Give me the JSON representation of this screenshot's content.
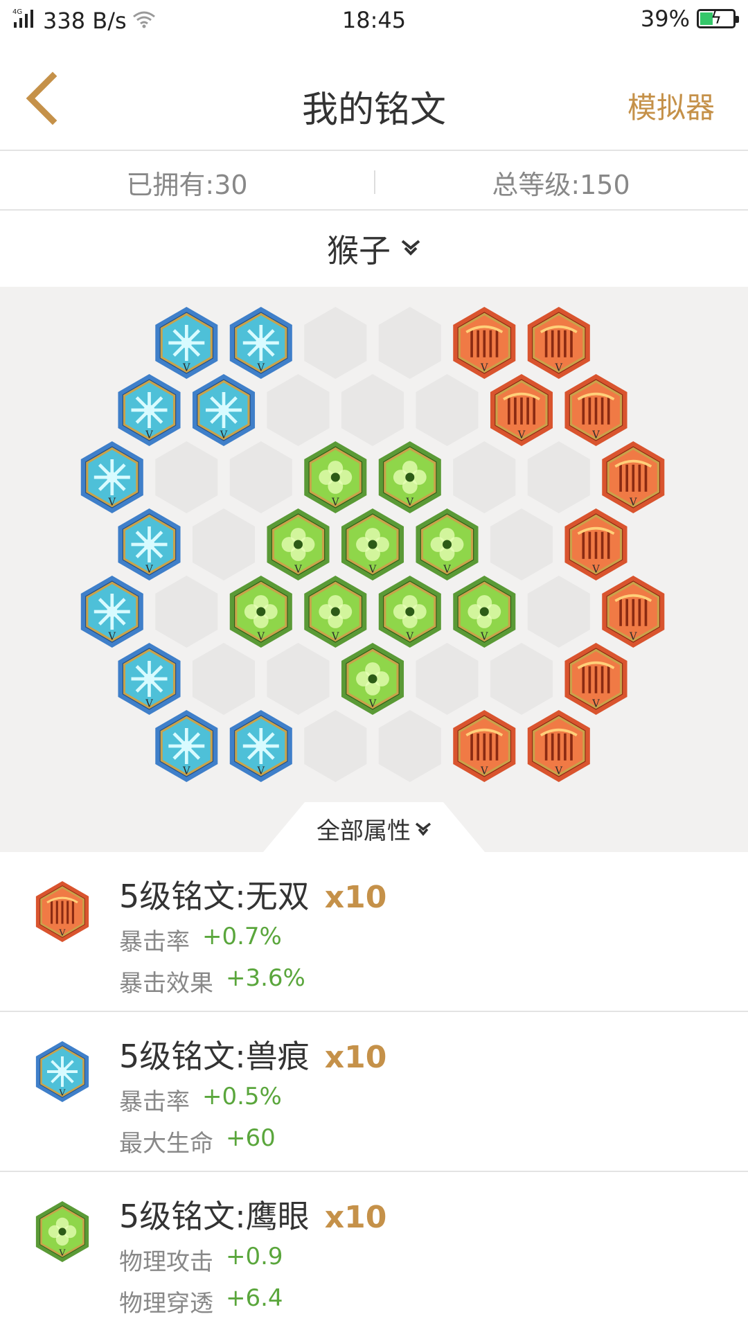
{
  "status_bar": {
    "network": "4G",
    "speed": "338 B/s",
    "time": "18:45",
    "battery": "39%",
    "battery_level": 0.39
  },
  "header": {
    "title": "我的铭文",
    "simulator_label": "模拟器",
    "back_icon": "chevron-left-icon"
  },
  "stats": {
    "owned": "已拥有:30",
    "total_level": "总等级:150"
  },
  "hero": {
    "name": "猴子",
    "dropdown_icon": "double-chevron-down-icon"
  },
  "board": {
    "columns": 8,
    "rows": 7,
    "cells": [
      [
        "blue",
        "blue",
        "empty",
        "empty",
        "red",
        "red"
      ],
      [
        "blue",
        "blue",
        "empty",
        "empty",
        "empty",
        "red",
        "red"
      ],
      [
        "blue",
        "empty",
        "empty",
        "green",
        "green",
        "empty",
        "empty",
        "red"
      ],
      [
        "blue",
        "empty",
        "green",
        "green",
        "green",
        "empty",
        "red"
      ],
      [
        "blue",
        "empty",
        "green",
        "green",
        "green",
        "green",
        "empty",
        "red"
      ],
      [
        "blue",
        "empty",
        "empty",
        "green",
        "empty",
        "empty",
        "red"
      ],
      [
        "blue",
        "blue",
        "empty",
        "empty",
        "red",
        "red"
      ]
    ],
    "colors": {
      "red": "#d9542e",
      "blue": "#3f7fc9",
      "green": "#5a9a36",
      "empty": "#e8e7e6"
    }
  },
  "attr_tab": {
    "label": "全部属性"
  },
  "runes": [
    {
      "color": "red",
      "name": "5级铭文:无双",
      "count": "x10",
      "attrs": [
        {
          "label": "暴击率",
          "value": "+0.7%"
        },
        {
          "label": "暴击效果",
          "value": "+3.6%"
        }
      ]
    },
    {
      "color": "blue",
      "name": "5级铭文:兽痕",
      "count": "x10",
      "attrs": [
        {
          "label": "暴击率",
          "value": "+0.5%"
        },
        {
          "label": "最大生命",
          "value": "+60"
        }
      ]
    },
    {
      "color": "green",
      "name": "5级铭文:鹰眼",
      "count": "x10",
      "attrs": [
        {
          "label": "物理攻击",
          "value": "+0.9"
        },
        {
          "label": "物理穿透",
          "value": "+6.4"
        }
      ]
    }
  ]
}
